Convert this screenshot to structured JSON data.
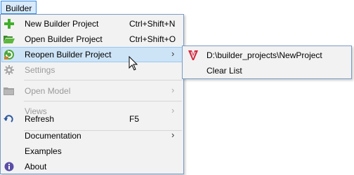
{
  "menubar": {
    "title": "Builder"
  },
  "menu": {
    "items": [
      {
        "label": "New Builder Project",
        "shortcut": "Ctrl+Shift+N",
        "icon": "plus-icon"
      },
      {
        "label": "Open Builder Project",
        "shortcut": "Ctrl+Shift+O",
        "icon": "folder-open-icon"
      },
      {
        "label": "Reopen Builder Project",
        "icon": "reopen-icon",
        "has_submenu": true,
        "highlighted": true
      },
      {
        "label": "Settings",
        "icon": "gear-icon",
        "disabled": true
      },
      {
        "label": "Open Model",
        "icon": "model-icon",
        "disabled": true,
        "has_submenu": true
      },
      {
        "label": "Views",
        "disabled": true,
        "has_submenu": true
      },
      {
        "label": "Refresh",
        "shortcut": "F5",
        "icon": "refresh-icon"
      },
      {
        "label": "Documentation",
        "has_submenu": true
      },
      {
        "label": "Examples"
      },
      {
        "label": "About",
        "icon": "info-icon"
      }
    ]
  },
  "submenu": {
    "items": [
      {
        "label": "D:\\builder_projects\\NewProject",
        "icon": "project-logo-icon"
      },
      {
        "label": "Clear List"
      }
    ]
  },
  "colors": {
    "menu_bg": "#f2f2f2",
    "highlight_bg": "#cde4f7",
    "highlight_border": "#99c9ef",
    "disabled_text": "#9a9a9a",
    "plus_green": "#3fae2a",
    "info_purple": "#5a4ea8",
    "logo_red": "#d3273e"
  },
  "arrow_glyph": "›"
}
